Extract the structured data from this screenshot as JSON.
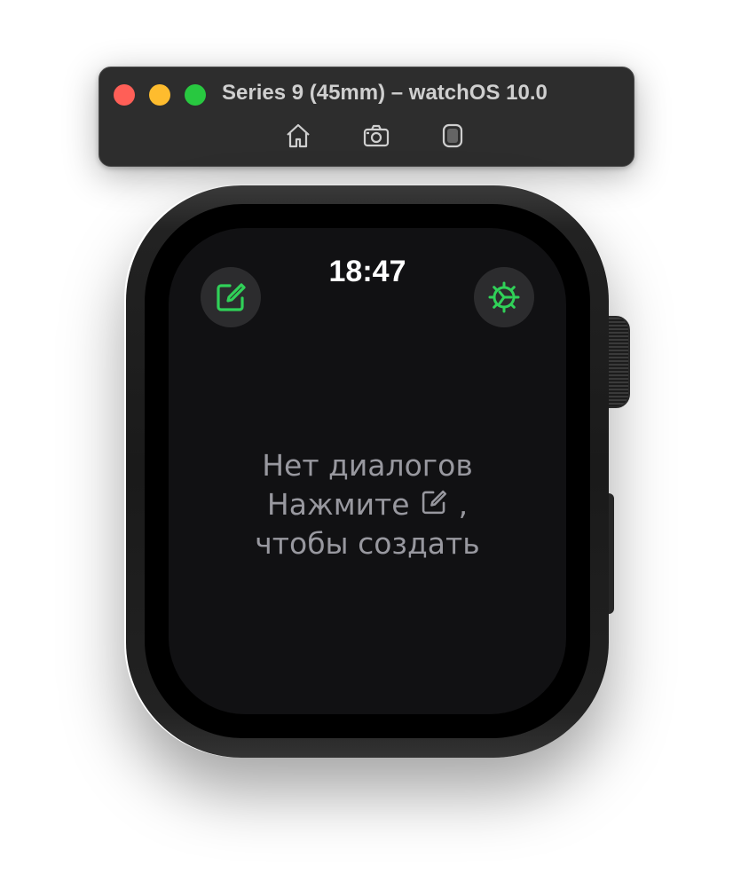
{
  "window": {
    "title": "Series 9 (45mm) – watchOS 10.0",
    "controls": [
      "close",
      "minimize",
      "zoom"
    ],
    "toolbar": [
      {
        "name": "home",
        "icon": "home-icon"
      },
      {
        "name": "screenshot",
        "icon": "camera-icon"
      },
      {
        "name": "rotate",
        "icon": "watch-rotate-icon"
      }
    ]
  },
  "watch": {
    "time": "18:47",
    "compose_button": {
      "icon": "compose-icon"
    },
    "settings_button": {
      "icon": "gear-icon"
    },
    "accent_color": "#30d158",
    "empty_state": {
      "line1": "Нет диалогов",
      "line2_prefix": "Нажмите",
      "line2_suffix": ",",
      "line3": "чтобы создать"
    }
  }
}
